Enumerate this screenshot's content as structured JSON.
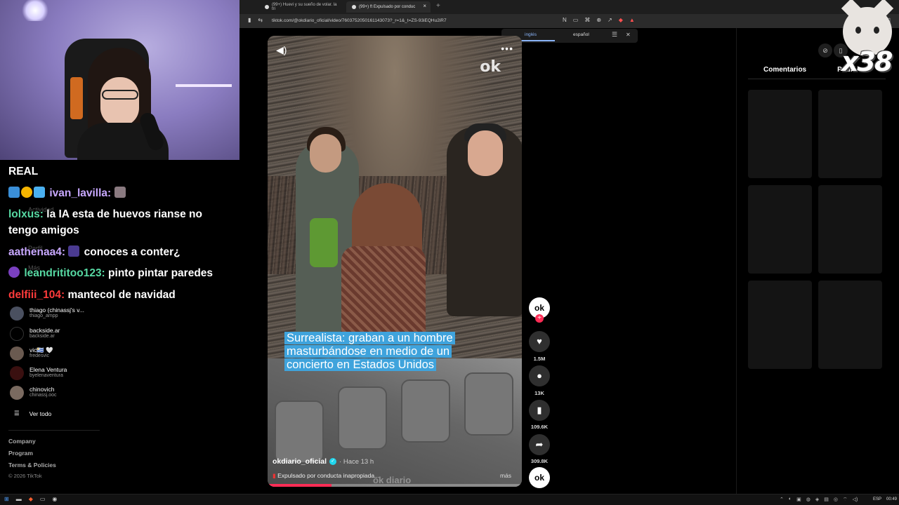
{
  "browser": {
    "tabs": [
      {
        "label": "(99+) Huevi y su sueño de volar. la tri"
      },
      {
        "label": "(99+) ft Expulsado por conduc"
      }
    ],
    "new_tab": "+",
    "url": "tiktok.com/@okdiario_oficial/video/7603752050161143073?_r=1&_t=ZS-93iEQHu2iR7",
    "translate": {
      "option_active": "inglés",
      "option_other": "español"
    }
  },
  "chat": {
    "header": "REAL",
    "lines": [
      {
        "user": "ivan_lavilla:",
        "user_color": "#c8a8ff",
        "message": ""
      },
      {
        "user": "lolxus:",
        "user_color": "#57d9a3",
        "message": "la IA esta de huevos rianse no",
        "message2": "tengo amigos"
      },
      {
        "user": "aathenaa4:",
        "user_color": "#c8a8ff",
        "message": "conoces a conter¿"
      },
      {
        "user": "leandrititoo123:",
        "user_color": "#57d9a3",
        "message": "pinto pintar paredes"
      },
      {
        "user": "delfiii_104:",
        "user_color": "#ff3b3b",
        "message": "mantecol de navidad"
      }
    ]
  },
  "sidebar": {
    "faded_items": [
      "Actividad",
      "Perfil",
      "Más"
    ],
    "following": [
      {
        "name": "thiago (chinassj's v...",
        "handle": "thiago_ampp"
      },
      {
        "name": "backside.ar",
        "handle": "backside.ar"
      },
      {
        "name": "vic🇺🇾 🤍",
        "handle": "fredesvic"
      },
      {
        "name": "Elena Ventura",
        "handle": "byelenaventura"
      },
      {
        "name": "chinovich",
        "handle": "chinassj.ooc"
      }
    ],
    "see_all": "Ver todo",
    "footer": [
      "Company",
      "Program",
      "Terms & Policies"
    ],
    "copyright": "© 2026 TikTok"
  },
  "video": {
    "watermark": "ok",
    "caption": "Surrealista: graban a un hombre masturbándose en medio de un concierto en Estados Unidos",
    "author": "okdiario_oficial",
    "time": "· Hace 13 h",
    "description": "Expulsado por conducta inapropiada...",
    "more": "más",
    "bottom_watermark": "ok diario",
    "progress": 0.25
  },
  "actions": {
    "avatar_label": "ok",
    "likes": "1.5M",
    "comments": "13K",
    "saves": "109.6K",
    "shares": "309.8K"
  },
  "right_panel": {
    "tabs": [
      "Comentarios",
      "Podrí"
    ],
    "overlay_count": "x38"
  },
  "taskbar": {
    "lang": "ESP",
    "clock": "00:49"
  },
  "colors": {
    "accent": "#fe2c55",
    "caption_bg": "#3fa3dc",
    "verified": "#20d5ec"
  }
}
